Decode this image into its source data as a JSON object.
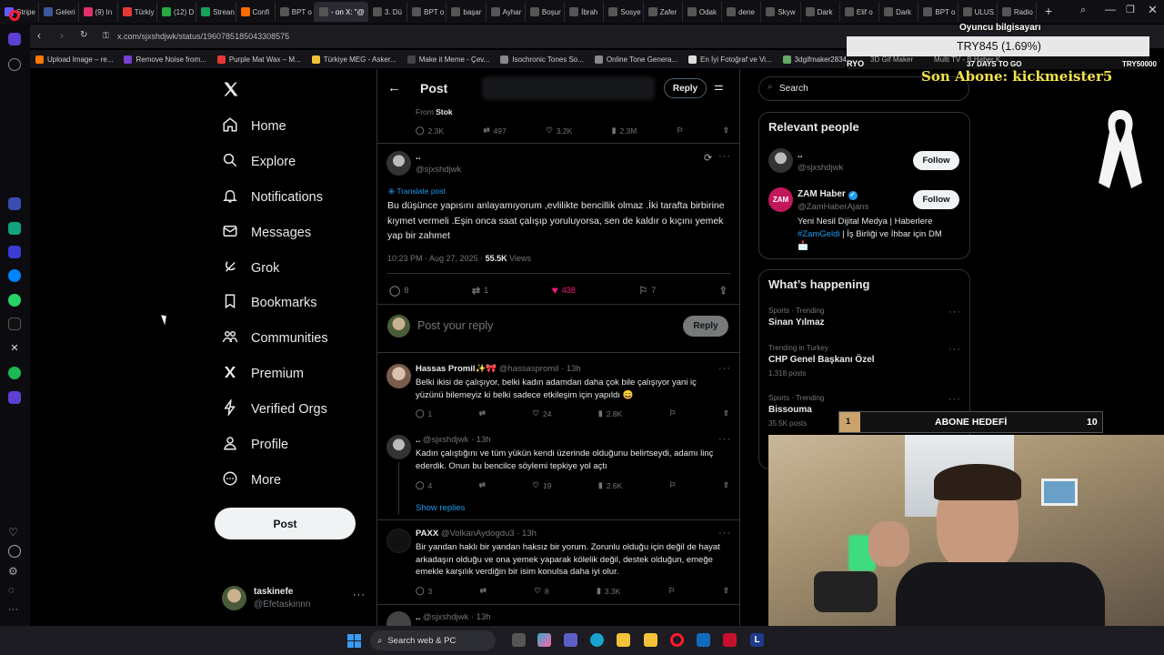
{
  "browser": {
    "tabs": [
      {
        "label": "Stripe",
        "color": "#635bff"
      },
      {
        "label": "Geleri",
        "color": "#3b5998"
      },
      {
        "label": "(9) In",
        "color": "#e1306c"
      },
      {
        "label": "Türkiy",
        "color": "#e53935"
      },
      {
        "label": "(12) D",
        "color": "#29a745"
      },
      {
        "label": "Strean",
        "color": "#18a058"
      },
      {
        "label": "Confi",
        "color": "#ff6d00"
      },
      {
        "label": "BPT o",
        "color": "#555"
      },
      {
        "label": "- on X: \"@",
        "color": "#555",
        "active": true
      },
      {
        "label": "3. Dü",
        "color": "#555"
      },
      {
        "label": "BPT o",
        "color": "#555"
      },
      {
        "label": "başar",
        "color": "#555"
      },
      {
        "label": "Ayhar",
        "color": "#555"
      },
      {
        "label": "Boşur",
        "color": "#555"
      },
      {
        "label": "İbrah",
        "color": "#555"
      },
      {
        "label": "Sosye",
        "color": "#555"
      },
      {
        "label": "Zafer",
        "color": "#555"
      },
      {
        "label": "Odak",
        "color": "#555"
      },
      {
        "label": "dene",
        "color": "#555"
      },
      {
        "label": "Skyw",
        "color": "#555"
      },
      {
        "label": "Dark",
        "color": "#555"
      },
      {
        "label": "Elif o",
        "color": "#555"
      },
      {
        "label": "Dark",
        "color": "#555"
      },
      {
        "label": "BPT o",
        "color": "#555"
      },
      {
        "label": "ULUS",
        "color": "#555"
      },
      {
        "label": "Radio",
        "color": "#555"
      }
    ],
    "url": "x.com/sjxshdjwk/status/1960785185043308575",
    "bookmarks": [
      "Upload Image – re...",
      "Remove Noise from...",
      "Purple Mat Wax – M...",
      "Türkiye MEG - Asker...",
      "Make it Meme - Çev...",
      "Isochronic Tones So...",
      "Online Tone Genera...",
      "En İyi Fotoğraf ve Vi...",
      "3dgifmaker28349.gi..."
    ]
  },
  "nav": {
    "items": [
      "Home",
      "Explore",
      "Notifications",
      "Messages",
      "Grok",
      "Bookmarks",
      "Communities",
      "Premium",
      "Verified Orgs",
      "Profile",
      "More"
    ],
    "post_button": "Post",
    "account_name": "taskinefe",
    "account_handle": "@Efetaskinnn"
  },
  "post_header": {
    "title": "Post",
    "reply_button": "Reply"
  },
  "quoted_stats": {
    "from_label": "From",
    "from_name": "Stok",
    "replies": "2.3K",
    "reposts": "497",
    "likes": "3.2K",
    "views": "2.3M"
  },
  "main_post": {
    "name": "..",
    "handle": "@sjxshdjwk",
    "translate": "Translate post",
    "text": "Bu düşünce yapısını anlayamıyorum ,evlilikte bencillik olmaz .İki tarafta birbirine kıymet vermeli .Eşin onca saat çalışıp yoruluyorsa, sen de kaldır o kıçını yemek yap bir zahmet",
    "timestamp": "10:23 PM · Aug 27, 2025 · ",
    "views_count": "55.5K",
    "views_label": " Views",
    "replies": "8",
    "reposts": "1",
    "likes": "438",
    "bookmarks": "7"
  },
  "reply_box": {
    "placeholder": "Post your reply",
    "button": "Reply"
  },
  "replies": [
    {
      "name": "Hassas Promil✨🎀",
      "handle": "@hassaspromil · 13h",
      "text": "Belki ikisi de çalışıyor, belki kadın adamdan daha çok bile çalışıyor yani iç yüzünü bilemeyiz ki belki sadece etkileşim için yapıldı 😄",
      "replies": "1",
      "reposts": "",
      "likes": "24",
      "views": "2.8K"
    },
    {
      "name": "..",
      "handle": "@sjxshdjwk · 13h",
      "text": "Kadın çalıştığını ve tüm yükün kendi üzerinde olduğunu belirtseydi, adamı linç ederdik.  Onun bu bencilce söylemi tepkiye yol açtı",
      "replies": "4",
      "reposts": "",
      "likes": "19",
      "views": "2.6K",
      "show_replies": "Show replies"
    },
    {
      "name": "PAXX",
      "handle": "@VolkanAydogdu3 · 13h",
      "text": "Bir yandan haklı bir yandan haksız bir yorum. Zorunlu olduğu için değil de hayat arkadaşın olduğu ve ona yemek yaparak kölelik değil, destek olduğun, emeğe emekle karşılık verdiğin bir isim konulsa daha iyi olur.",
      "replies": "3",
      "reposts": "",
      "likes": "8",
      "views": "3.3K"
    },
    {
      "name": "..",
      "handle": "@sjxshdjwk · 13h"
    }
  ],
  "sidebar": {
    "search_placeholder": "Search",
    "relevant_title": "Relevant people",
    "people": [
      {
        "name": "..",
        "handle": "@sjxshdjwk",
        "follow": "Follow"
      },
      {
        "name": "ZAM Haber",
        "handle": "@ZamHaberAjans",
        "follow": "Follow",
        "avatar_text": "ZAM",
        "bio_a": "Yeni Nesil Dijital Medya | Haberlere ",
        "bio_tag": "#ZamGeldi",
        "bio_b": " | İş Birliği ve İhbar için DM",
        "bio_emoji": "📩"
      }
    ],
    "happening_title": "What’s happening",
    "trends": [
      {
        "meta": "Sports · Trending",
        "name": "Sinan Yılmaz",
        "posts": ""
      },
      {
        "meta": "Trending in Turkey",
        "name": "CHP Genel Başkanı Özel",
        "posts": "1,318 posts"
      },
      {
        "meta": "Sports · Trending",
        "name": "Bissouma",
        "posts": "35.5K posts"
      }
    ]
  },
  "overlay": {
    "pc_title": "Oyuncu bilgisayarı",
    "donation": "TRY845 (1.69%)",
    "left_small": "RYO",
    "days": "37 DAYS TO GO",
    "goal": "TRY50000",
    "last_sub": "Son Abone: kickmeister5",
    "sub_goal_label": "ABONE HEDEFİ",
    "sub_goal_current": "1",
    "sub_goal_target": "10",
    "extra_bm": [
      "3D Gif Maker",
      "Multi TV - B Haber K"
    ]
  },
  "taskbar": {
    "search": "Search web & PC"
  }
}
